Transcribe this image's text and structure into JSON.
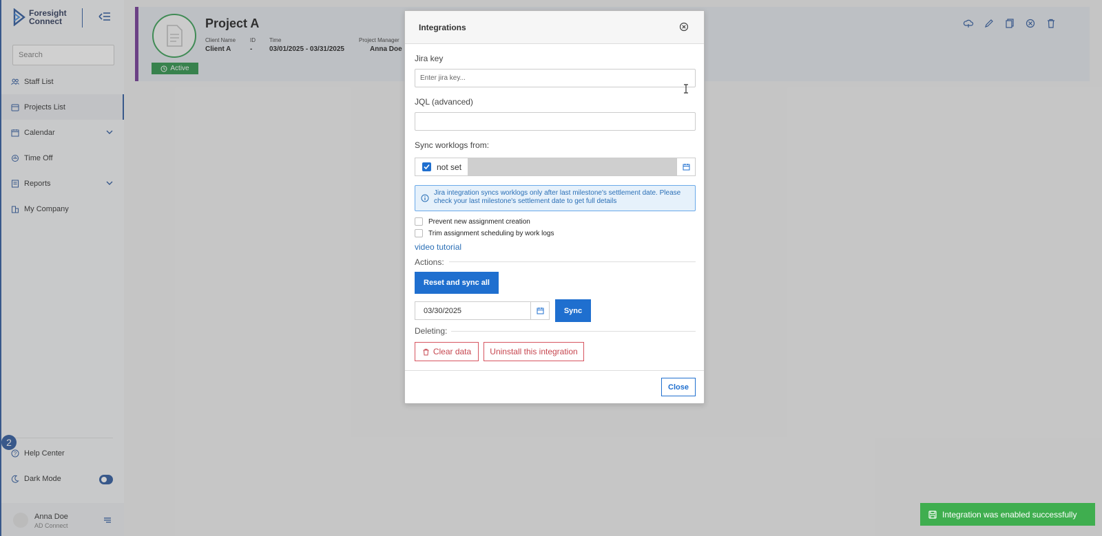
{
  "sidebar": {
    "logo_line1": "Foresight",
    "logo_line2": "Connect",
    "search_placeholder": "Search",
    "items": [
      {
        "label": "Staff List"
      },
      {
        "label": "Projects List"
      },
      {
        "label": "Calendar"
      },
      {
        "label": "Time Off"
      },
      {
        "label": "Reports"
      },
      {
        "label": "My Company"
      }
    ],
    "badge_count": "2",
    "help_center": "Help Center",
    "dark_mode": "Dark Mode",
    "user": {
      "name": "Anna Doe",
      "org": "AD Connect"
    }
  },
  "project": {
    "title": "Project A",
    "status": "Active",
    "client_name_label": "Client Name",
    "client_name": "Client A",
    "id_label": "ID",
    "id_value": "-",
    "time_label": "Time",
    "time_value": "03/01/2025 - 03/31/2025",
    "manager_label": "Project Manager",
    "manager_value": "Anna Doe"
  },
  "modal": {
    "title": "Integrations",
    "jira_key_label": "Jira key",
    "jira_key_placeholder": "Enter jira key...",
    "jira_key_value": "",
    "jql_label": "JQL (advanced)",
    "jql_value": "",
    "sync_label": "Sync worklogs from:",
    "not_set_label": "not set",
    "not_set_checked": true,
    "info_text": "Jira integration syncs worklogs only after last milestone's settlement date. Please check your last milestone's settlement date to get full details",
    "prevent_label": "Prevent new assignment creation",
    "trim_label": "Trim assignment scheduling by work logs",
    "video_link": "video tutorial",
    "actions_label": "Actions:",
    "reset_button": "Reset and sync all",
    "sync_date": "03/30/2025",
    "sync_button": "Sync",
    "deleting_label": "Deleting:",
    "clear_button": "Clear data",
    "uninstall_button": "Uninstall this integration",
    "close_button": "Close"
  },
  "toast": {
    "message": "Integration was enabled successfully",
    "color": "#3fae4f"
  },
  "colors": {
    "primary": "#1f6fcf",
    "nav_accent": "#1f4f99",
    "danger": "#c6464f",
    "status_active": "#1f8d3f"
  }
}
